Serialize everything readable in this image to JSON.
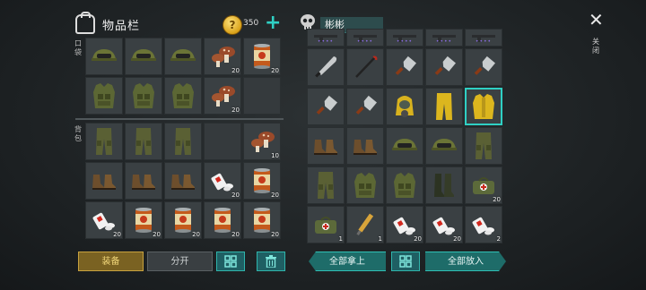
{
  "inventory": {
    "title": "物品栏",
    "coins": "350",
    "pocket_label": "口袋",
    "backpack_label": "背包",
    "pocket_rows": [
      [
        {
          "icon": "military-helmet-icon",
          "count": ""
        },
        {
          "icon": "military-helmet-icon",
          "count": ""
        },
        {
          "icon": "military-helmet-icon",
          "count": ""
        },
        {
          "icon": "mushroom-icon",
          "count": "20"
        },
        {
          "icon": "canned-food-icon",
          "count": "20"
        }
      ],
      [
        {
          "icon": "tactical-vest-icon",
          "count": ""
        },
        {
          "icon": "tactical-vest-icon",
          "count": ""
        },
        {
          "icon": "tactical-vest-icon",
          "count": ""
        },
        {
          "icon": "mushroom-icon",
          "count": "20"
        },
        {
          "icon": "empty",
          "count": ""
        }
      ]
    ],
    "backpack_rows": [
      [
        {
          "icon": "cargo-pants-icon",
          "count": ""
        },
        {
          "icon": "cargo-pants-icon",
          "count": ""
        },
        {
          "icon": "cargo-pants-icon",
          "count": ""
        },
        {
          "icon": "empty",
          "count": ""
        },
        {
          "icon": "mushroom-icon",
          "count": "10"
        }
      ],
      [
        {
          "icon": "boots-icon",
          "count": ""
        },
        {
          "icon": "boots-icon",
          "count": ""
        },
        {
          "icon": "boots-icon",
          "count": ""
        },
        {
          "icon": "pills-icon",
          "count": "20"
        },
        {
          "icon": "canned-food-icon",
          "count": "20"
        }
      ],
      [
        {
          "icon": "pills-icon",
          "count": "20"
        },
        {
          "icon": "canned-food-icon",
          "count": "20"
        },
        {
          "icon": "canned-food-icon",
          "count": "20"
        },
        {
          "icon": "canned-food-icon",
          "count": "20"
        },
        {
          "icon": "canned-food-icon",
          "count": "20"
        }
      ]
    ],
    "equip_label": "装备",
    "split_label": "分开"
  },
  "container": {
    "name": "彬彬",
    "close_label": "关闭",
    "rows": [
      [
        {
          "icon": "rifle-icon",
          "count": "",
          "dots": true
        },
        {
          "icon": "rifle-icon",
          "count": "",
          "dots": true
        },
        {
          "icon": "rifle-icon",
          "count": "",
          "dots": true
        },
        {
          "icon": "rifle-icon",
          "count": "",
          "dots": true
        },
        {
          "icon": "rifle-icon",
          "count": "",
          "dots": true
        }
      ],
      [
        {
          "icon": "machete-icon",
          "count": "",
          "dots": false
        },
        {
          "icon": "crowbar-icon",
          "count": "",
          "dots": false
        },
        {
          "icon": "cleaver-icon",
          "count": "",
          "dots": false
        },
        {
          "icon": "cleaver-icon",
          "count": "",
          "dots": false
        },
        {
          "icon": "cleaver-icon",
          "count": "",
          "dots": false
        }
      ],
      [
        {
          "icon": "cleaver-icon",
          "count": "",
          "dots": false
        },
        {
          "icon": "cleaver-icon",
          "count": "",
          "dots": false
        },
        {
          "icon": "hazmat-hood-icon",
          "count": "",
          "dots": false
        },
        {
          "icon": "hazmat-pants-icon",
          "count": "",
          "dots": false
        },
        {
          "icon": "hazmat-suit-icon",
          "count": "",
          "dots": false
        }
      ],
      [
        {
          "icon": "boots-icon",
          "count": "",
          "dots": false
        },
        {
          "icon": "boots-icon",
          "count": "",
          "dots": false
        },
        {
          "icon": "military-helmet-icon",
          "count": "",
          "dots": false
        },
        {
          "icon": "military-helmet-icon",
          "count": "",
          "dots": false
        },
        {
          "icon": "cargo-pants-icon",
          "count": "",
          "dots": false
        }
      ],
      [
        {
          "icon": "cargo-pants-icon",
          "count": "",
          "dots": false
        },
        {
          "icon": "tactical-vest-icon",
          "count": "",
          "dots": false
        },
        {
          "icon": "tactical-vest-icon",
          "count": "",
          "dots": false
        },
        {
          "icon": "rubber-boots-icon",
          "count": "",
          "dots": false
        },
        {
          "icon": "medkit-bag-icon",
          "count": "20",
          "dots": false
        }
      ],
      [
        {
          "icon": "medkit-bag-icon",
          "count": "1",
          "dots": false
        },
        {
          "icon": "syringe-icon",
          "count": "1",
          "dots": false
        },
        {
          "icon": "pills-icon",
          "count": "20",
          "dots": false
        },
        {
          "icon": "pills-icon",
          "count": "20",
          "dots": false
        },
        {
          "icon": "pills-icon",
          "count": "2",
          "dots": false
        }
      ]
    ],
    "take_all_label": "全部拿上",
    "put_all_label": "全部放入"
  },
  "colors": {
    "accent": "#2fd0c4",
    "gold": "#c8a23e",
    "bg": "#1e2224"
  }
}
